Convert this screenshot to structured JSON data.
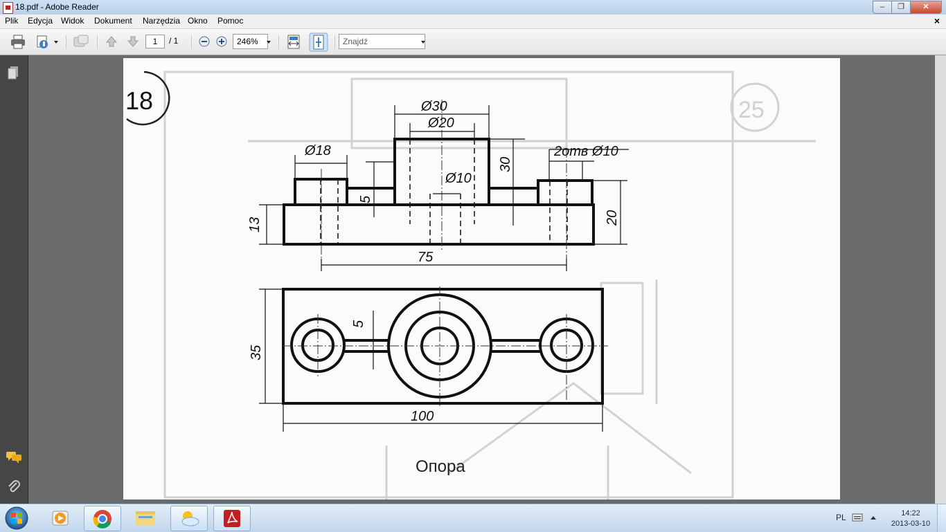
{
  "window": {
    "title": "18.pdf - Adobe Reader"
  },
  "menu": {
    "items": [
      "Plik",
      "Edycja",
      "Widok",
      "Dokument",
      "Narzędzia",
      "Okno",
      "Pomoc"
    ]
  },
  "toolbar": {
    "page_current": "1",
    "page_total": "/ 1",
    "zoom": "246%",
    "find_placeholder": "Znajdź"
  },
  "drawing": {
    "number": "18",
    "ghost_number": "25",
    "caption": "Опора",
    "dims": {
      "d30": "Ø30",
      "d20": "Ø20",
      "d18": "Ø18",
      "d10": "Ø10",
      "holes": "2отв Ø10",
      "h30": "30",
      "h5": "5",
      "h13": "13",
      "h20": "20",
      "w75": "75",
      "h35": "35",
      "w100": "100",
      "top5": "5"
    }
  },
  "taskbar": {
    "language": "PL",
    "time": "14:22",
    "date": "2013-03-10"
  },
  "colors": {
    "taskbar": "#c2d6ec",
    "accent_red": "#c41e1e",
    "viewer_bg": "#6b6b6b"
  }
}
